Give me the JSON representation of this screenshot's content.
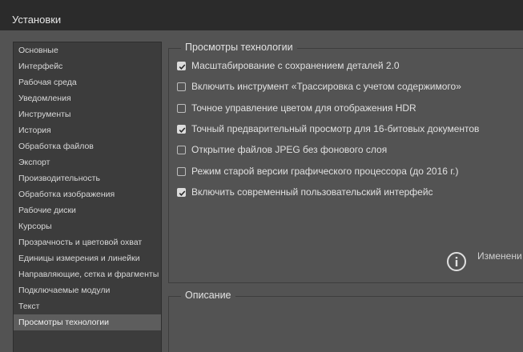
{
  "window": {
    "title": "Установки"
  },
  "sidebar": {
    "items": [
      {
        "label": "Основные"
      },
      {
        "label": "Интерфейс"
      },
      {
        "label": "Рабочая среда"
      },
      {
        "label": "Уведомления"
      },
      {
        "label": "Инструменты"
      },
      {
        "label": "История"
      },
      {
        "label": "Обработка файлов"
      },
      {
        "label": "Экспорт"
      },
      {
        "label": "Производительность"
      },
      {
        "label": "Обработка изображения"
      },
      {
        "label": "Рабочие диски"
      },
      {
        "label": "Курсоры"
      },
      {
        "label": "Прозрачность и цветовой охват"
      },
      {
        "label": "Единицы измерения и линейки"
      },
      {
        "label": "Направляющие, сетка и фрагменты"
      },
      {
        "label": "Подключаемые модули"
      },
      {
        "label": "Текст"
      },
      {
        "label": "Просмотры технологии"
      }
    ],
    "selected": "Просмотры технологии"
  },
  "tech_previews": {
    "legend": "Просмотры технологии",
    "options": [
      {
        "label": "Масштабирование с сохранением деталей 2.0",
        "checked": true
      },
      {
        "label": "Включить инструмент «Трассировка с учетом содержимого»",
        "checked": false
      },
      {
        "label": "Точное управление цветом для отображения HDR",
        "checked": false
      },
      {
        "label": "Точный предварительный просмотр для 16-битовых документов",
        "checked": true
      },
      {
        "label": "Открытие файлов JPEG без фонового слоя",
        "checked": false
      },
      {
        "label": "Режим старой версии графического процессора (до 2016 г.)",
        "checked": false
      },
      {
        "label": "Включить современный пользовательский интерфейс",
        "checked": true
      }
    ],
    "info_text": "Изменени",
    "info_icon": "info-icon"
  },
  "description": {
    "legend": "Описание"
  },
  "colors": {
    "window_bg": "#535353",
    "titlebar_bg": "#2b2b2b",
    "sidebar_bg": "#3c3c3c",
    "selected_item_bg": "#5d5d5d"
  }
}
